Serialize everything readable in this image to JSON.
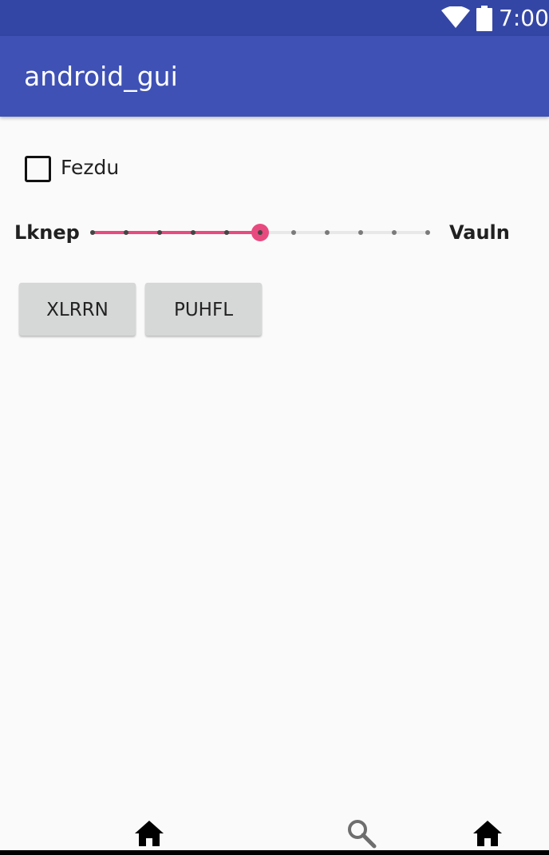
{
  "status_bar": {
    "time": "7:00",
    "icons": [
      "wifi-icon",
      "battery-icon"
    ],
    "background": "#3446a5"
  },
  "app_bar": {
    "title": "android_gui",
    "background": "#3f51b5"
  },
  "checkbox": {
    "label": "Fezdu",
    "checked": false
  },
  "seekbar": {
    "left_label": "Lknep",
    "right_label": "Vauln",
    "max": 10,
    "progress": 5,
    "accent": "#e84a7f"
  },
  "buttons": {
    "first_label": "XLRRN",
    "second_label": "PUHFL"
  },
  "bottom_nav": {
    "icons": [
      "home-icon",
      "search-icon",
      "home-icon"
    ]
  }
}
